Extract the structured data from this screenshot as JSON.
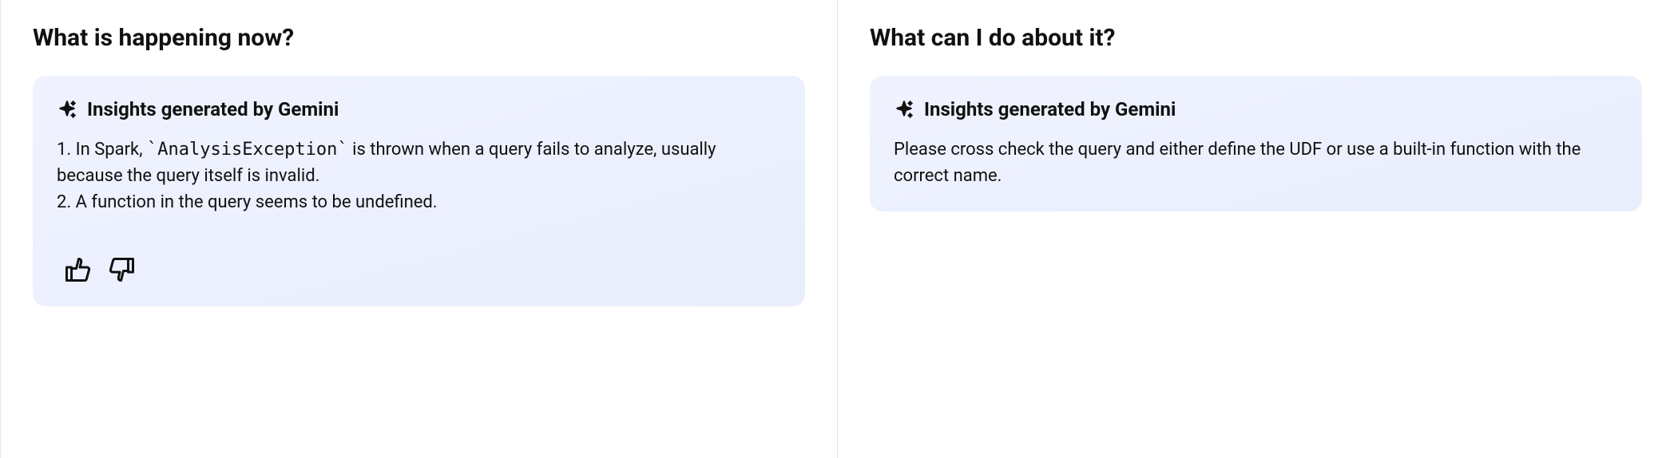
{
  "left": {
    "title": "What is happening now?",
    "card": {
      "header": "Insights generated by Gemini",
      "items": [
        {
          "prefix": "In Spark, ",
          "code": "`AnalysisException`",
          "suffix": " is thrown when a query fails to analyze, usually because the query itself is invalid."
        },
        {
          "text": "A function in the query seems to be undefined."
        }
      ]
    }
  },
  "right": {
    "title": "What can I do about it?",
    "card": {
      "header": "Insights generated by Gemini",
      "body": "Please cross check the query and either define the UDF or use a built-in function with the correct name."
    }
  }
}
